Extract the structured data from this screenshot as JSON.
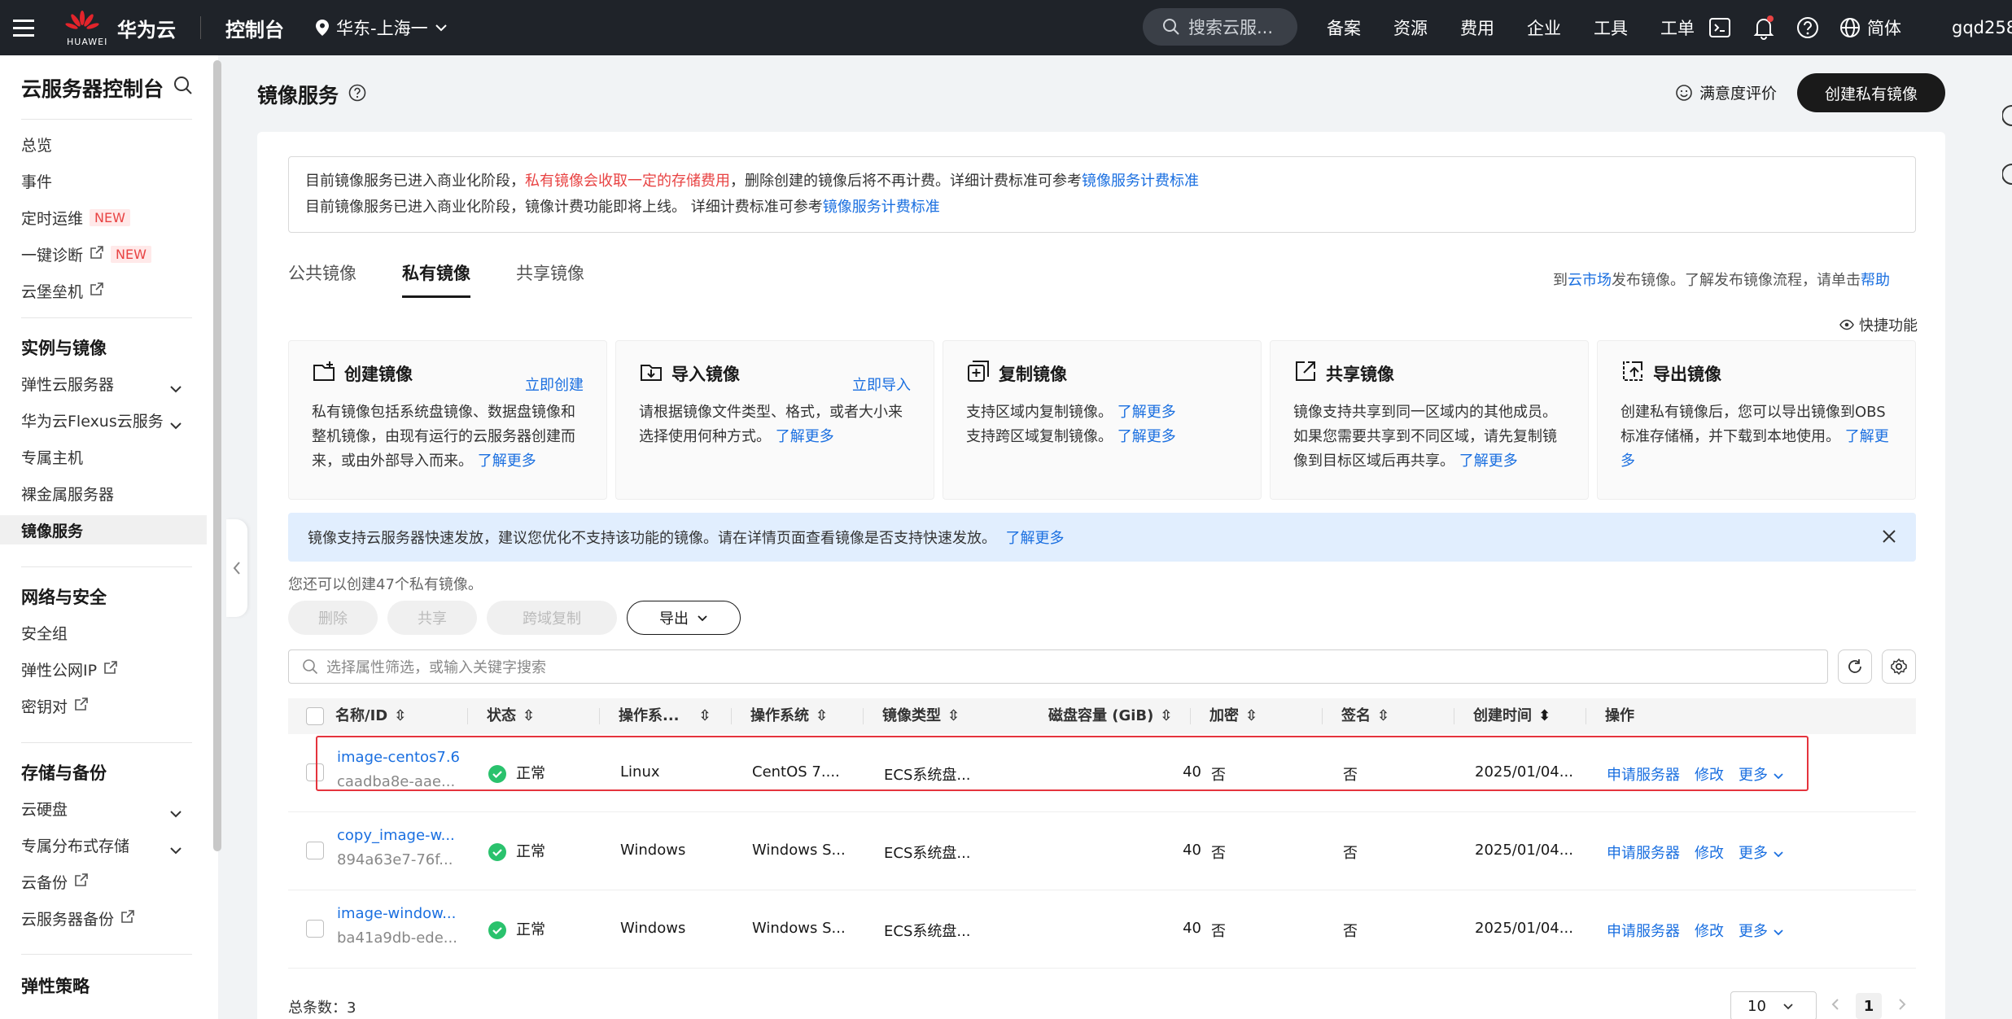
{
  "topbar": {
    "logo_text": "HUAWEI",
    "brand": "华为云",
    "console": "控制台",
    "region": "华东-上海一",
    "search_placeholder": "搜索云服...",
    "nav": [
      "备案",
      "资源",
      "费用",
      "企业",
      "工具",
      "工单"
    ],
    "language": "简体",
    "user": "gqd258"
  },
  "sidebar": {
    "title": "云服务器控制台",
    "top_items": [
      {
        "label": "总览"
      },
      {
        "label": "事件"
      },
      {
        "label": "定时运维",
        "badge": "NEW"
      },
      {
        "label": "一键诊断",
        "badge": "NEW"
      },
      {
        "label": "云堡垒机"
      }
    ],
    "group_instances": "实例与镜像",
    "instances_items": [
      "弹性云服务器",
      "华为云Flexus云服务",
      "专属主机",
      "裸金属服务器",
      "镜像服务"
    ],
    "group_network": "网络与安全",
    "network_items": [
      "安全组",
      "弹性公网IP",
      "密钥对"
    ],
    "group_storage": "存储与备份",
    "storage_items": [
      "云硬盘",
      "专属分布式存储",
      "云备份",
      "云服务器备份"
    ],
    "group_policy": "弹性策略"
  },
  "main": {
    "page_title": "镜像服务",
    "satisfaction": "满意度评价",
    "create_button": "创建私有镜像",
    "notice_line1_a": "目前镜像服务已进入商业化阶段，",
    "notice_line1_red": "私有镜像会收取一定的存储费用",
    "notice_line1_b": "，删除创建的镜像后将不再计费。详细计费标准可参考",
    "notice_link": "镜像服务计费标准",
    "notice_line2": "目前镜像服务已进入商业化阶段，镜像计费功能即将上线。 详细计费标准可参考",
    "tabs": [
      "公共镜像",
      "私有镜像",
      "共享镜像"
    ],
    "tabs_right_a": "到",
    "tabs_right_link1": "云市场",
    "tabs_right_b": "发布镜像。了解发布镜像流程，请单击",
    "tabs_right_link2": "帮助",
    "quick_features": "快捷功能",
    "quick_cards": [
      {
        "title": "创建镜像",
        "action": "立即创建",
        "desc": "私有镜像包括系统盘镜像、数据盘镜像和整机镜像，由现有运行的云服务器创建而来，或由外部导入而来。",
        "more": "了解更多"
      },
      {
        "title": "导入镜像",
        "action": "立即导入",
        "desc": "请根据镜像文件类型、格式，或者大小来选择使用何种方式。",
        "more": "了解更多"
      },
      {
        "title": "复制镜像",
        "action": "",
        "desc1": "支持区域内复制镜像。",
        "desc2": "支持跨区域复制镜像。",
        "more": "了解更多"
      },
      {
        "title": "共享镜像",
        "action": "",
        "desc": "镜像支持共享到同一区域内的其他成员。如果您需要共享到不同区域，请先复制镜像到目标区域后再共享。",
        "more": "了解更多"
      },
      {
        "title": "导出镜像",
        "action": "",
        "desc": "创建私有镜像后，您可以导出镜像到OBS标准存储桶，并下载到本地使用。",
        "more": "了解更多"
      }
    ],
    "info_bar": "镜像支持云服务器快速发放，建议您优化不支持该功能的镜像。请在详情页面查看镜像是否支持快速发放。",
    "info_more": "了解更多",
    "quota_text": "您还可以创建47个私有镜像。",
    "buttons": {
      "delete": "删除",
      "share": "共享",
      "cross_copy": "跨域复制",
      "export": "导出"
    },
    "filter_placeholder": "选择属性筛选，或输入关键字搜索"
  },
  "table": {
    "columns": [
      "名称/ID",
      "状态",
      "操作系...",
      "操作系统",
      "镜像类型",
      "磁盘容量 (GiB)",
      "加密",
      "签名",
      "创建时间",
      "操作"
    ],
    "rows": [
      {
        "name": "image-centos7.6",
        "id": "caadba8e-aae...",
        "status": "正常",
        "os_type": "Linux",
        "os": "CentOS 7....",
        "image_type": "ECS系统盘...",
        "disk": "40",
        "encrypted": "否",
        "signed": "否",
        "created": "2025/01/04...",
        "op1": "申请服务器",
        "op2": "修改",
        "op3": "更多"
      },
      {
        "name": "copy_image-w...",
        "id": "894a63e7-76f...",
        "status": "正常",
        "os_type": "Windows",
        "os": "Windows S...",
        "image_type": "ECS系统盘...",
        "disk": "40",
        "encrypted": "否",
        "signed": "否",
        "created": "2025/01/04...",
        "op1": "申请服务器",
        "op2": "修改",
        "op3": "更多"
      },
      {
        "name": "image-window...",
        "id": "ba41a9db-ede...",
        "status": "正常",
        "os_type": "Windows",
        "os": "Windows S...",
        "image_type": "ECS系统盘...",
        "disk": "40",
        "encrypted": "否",
        "signed": "否",
        "created": "2025/01/04...",
        "op1": "申请服务器",
        "op2": "修改",
        "op3": "更多"
      }
    ],
    "total_label": "总条数：3",
    "page_size": "10",
    "current_page": "1"
  },
  "colors": {
    "accent": "#1a6fe0",
    "danger": "#e84343",
    "ok": "#2ac26d",
    "topbar": "#1f2329"
  }
}
